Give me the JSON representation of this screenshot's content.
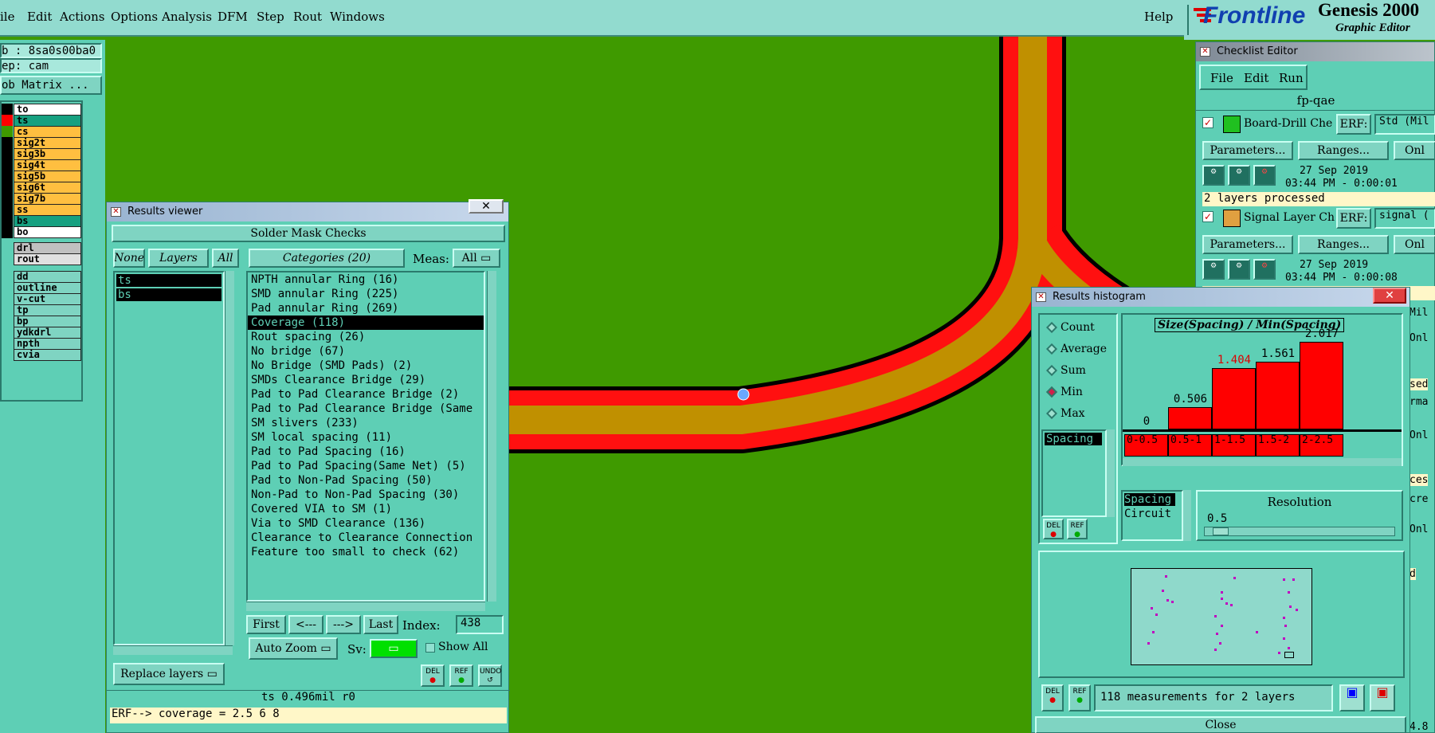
{
  "menubar": {
    "items": [
      "ile",
      "Edit",
      "Actions",
      "Options",
      "Analysis",
      "DFM",
      "Step",
      "Rout",
      "Windows"
    ],
    "help": "Help",
    "brand": "Frontline",
    "app_title": "Genesis 2000",
    "app_subtitle": "Graphic Editor"
  },
  "left_panel": {
    "job": "b : 8sa0s00ba0",
    "step": "ep: cam",
    "job_matrix": "ob Matrix ...",
    "layers": [
      {
        "name": "to",
        "bg": "#ffffff",
        "swatch": "#000000"
      },
      {
        "name": "ts",
        "bg": "#16a080",
        "swatch": "#ff0000"
      },
      {
        "name": "cs",
        "bg": "#ffbf40",
        "swatch": "#3f9a00"
      },
      {
        "name": "sig2t",
        "bg": "#ffbf40",
        "swatch": "#000000"
      },
      {
        "name": "sig3b",
        "bg": "#ffbf40",
        "swatch": "#000000"
      },
      {
        "name": "sig4t",
        "bg": "#ffbf40",
        "swatch": "#000000"
      },
      {
        "name": "sig5b",
        "bg": "#ffbf40",
        "swatch": "#000000"
      },
      {
        "name": "sig6t",
        "bg": "#ffbf40",
        "swatch": "#000000"
      },
      {
        "name": "sig7b",
        "bg": "#ffbf40",
        "swatch": "#000000"
      },
      {
        "name": "ss",
        "bg": "#ffbf40",
        "swatch": "#000000"
      },
      {
        "name": "bs",
        "bg": "#16a080",
        "swatch": "#000000"
      },
      {
        "name": "bo",
        "bg": "#ffffff",
        "swatch": "#000000"
      }
    ],
    "drill_layers": [
      {
        "name": "drl",
        "bg": "#c0c0c0"
      },
      {
        "name": "rout",
        "bg": "#e0e0e0"
      }
    ],
    "misc_layers": [
      "dd",
      "outline",
      "v-cut",
      "tp",
      "bp",
      "ydkdrl",
      "npth",
      "cvia"
    ]
  },
  "results_viewer": {
    "window_title": "Results viewer",
    "header": "Solder Mask Checks",
    "none_label": "None",
    "layers_label": "Layers",
    "all_label": "All",
    "categories_label": "Categories (20)",
    "meas_label": "Meas:",
    "meas_value": "All",
    "selected_layers": [
      "ts",
      "bs"
    ],
    "categories": [
      "NPTH annular Ring (16)",
      "SMD annular Ring (225)",
      "Pad annular Ring (269)",
      "Coverage (118)",
      "Rout spacing (26)",
      "No bridge (67)",
      "No Bridge (SMD Pads) (2)",
      "SMDs Clearance Bridge (29)",
      "Pad to Pad Clearance Bridge (2)",
      "Pad to Pad Clearance Bridge (Same",
      "SM slivers (233)",
      "SM local spacing (11)",
      "Pad to Pad Spacing (16)",
      "Pad to Pad Spacing(Same Net) (5)",
      "Pad to Non-Pad Spacing (50)",
      "Non-Pad to Non-Pad Spacing (30)",
      "Covered VIA to SM (1)",
      "Via to SMD Clearance (136)",
      "Clearance to Clearance Connection",
      "Feature too small to check (62)"
    ],
    "selected_category": "Coverage (118)",
    "nav": {
      "first": "First",
      "prev": "<---",
      "next": "--->",
      "last": "Last",
      "index_label": "Index:",
      "index_value": "438"
    },
    "auto_zoom": "Auto Zoom",
    "sv_label": "Sv:",
    "show_all": "Show All",
    "replace_layers": "Replace layers",
    "del": "DEL",
    "ref": "REF",
    "undo": "UNDO",
    "status": "ts 0.496mil  r0",
    "erf_line": "ERF--> coverage = 2.5 6 8"
  },
  "checklist_editor": {
    "window_title": "Checklist Editor",
    "menu": [
      "File",
      "Edit",
      "Run"
    ],
    "checklist_name": "fp-qae",
    "checks": [
      {
        "name": "Board-Drill Che",
        "erf_label": "ERF:",
        "erf_value": "Std (Mil",
        "params": "Parameters...",
        "ranges": "Ranges...",
        "onl": "Onl",
        "date": "27 Sep 2019",
        "time": "03:44 PM - 0:00:01",
        "result": "2 layers processed"
      },
      {
        "name": "Signal Layer Ch",
        "erf_label": "ERF:",
        "erf_value": "signal (",
        "params": "Parameters...",
        "ranges": "Ranges...",
        "onl": "Onl",
        "date": "27 Sep 2019",
        "time": "03:44 PM - 0:00:08",
        "result": ""
      }
    ],
    "edge_fragments": [
      "Mil",
      "Onl",
      "sed",
      "rma",
      "Onl",
      "ces",
      "cre",
      "Onl",
      "d",
      "4.8"
    ]
  },
  "histogram": {
    "window_title": "Results histogram",
    "modes": [
      "Count",
      "Average",
      "Sum",
      "Min",
      "Max"
    ],
    "selected_mode": "Min",
    "measure_list": [
      "Spacing"
    ],
    "chart_title": "Size(Spacing) / Min(Spacing)",
    "resolution_label": "Resolution",
    "resolution_value": "0.5",
    "attr_list": [
      "Spacing",
      "Circuit"
    ],
    "summary": "118 measurements for 2 layers",
    "del": "DEL",
    "ref": "REF",
    "close": "Close"
  },
  "chart_data": {
    "type": "bar",
    "title": "Size(Spacing) / Min(Spacing)",
    "categories": [
      "0-0.5",
      "0.5-1",
      "1-1.5",
      "1.5-2",
      "2-2.5"
    ],
    "values": [
      0,
      0.506,
      1.404,
      1.561,
      2.017
    ],
    "value_labels": [
      "0",
      "0.506",
      "1.404",
      "1.561",
      "2.017"
    ],
    "xlabel": "",
    "ylabel": "",
    "ylim": [
      0,
      2.017
    ],
    "grid": false,
    "color": "#ff0000"
  }
}
